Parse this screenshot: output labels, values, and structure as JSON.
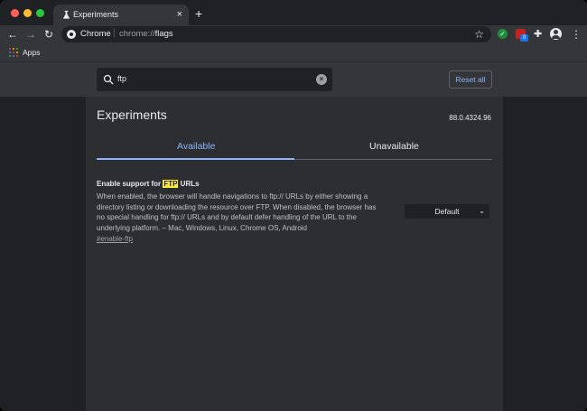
{
  "browser": {
    "tab_title": "Experiments",
    "tab_close": "×",
    "new_tab": "+",
    "omnibox": {
      "site": "Chrome",
      "url_scheme": "chrome://",
      "url_path": "flags"
    },
    "bookmarks": {
      "apps_label": "Apps"
    },
    "extension_badge": "0"
  },
  "search": {
    "query": "ftp"
  },
  "header": {
    "reset_label": "Reset all"
  },
  "page": {
    "title": "Experiments",
    "version": "88.0.4324.96",
    "tabs": [
      {
        "label": "Available",
        "active": true
      },
      {
        "label": "Unavailable",
        "active": false
      }
    ]
  },
  "flag": {
    "name_prefix": "Enable support for ",
    "name_highlight": "FTP",
    "name_suffix": " URLs",
    "description": "When enabled, the browser will handle navigations to ftp:// URLs by either showing a directory listing or downloading the resource over FTP. When disabled, the browser has no special handling for ftp:// URLs and by default defer handling of the URL to the underlying platform. – Mac, Windows, Linux, Chrome OS, Android",
    "link": "#enable-ftp",
    "selected_option": "Default"
  },
  "colors": {
    "accent": "#8ab4f8",
    "highlight": "#ffeb3b",
    "background": "#202124"
  }
}
